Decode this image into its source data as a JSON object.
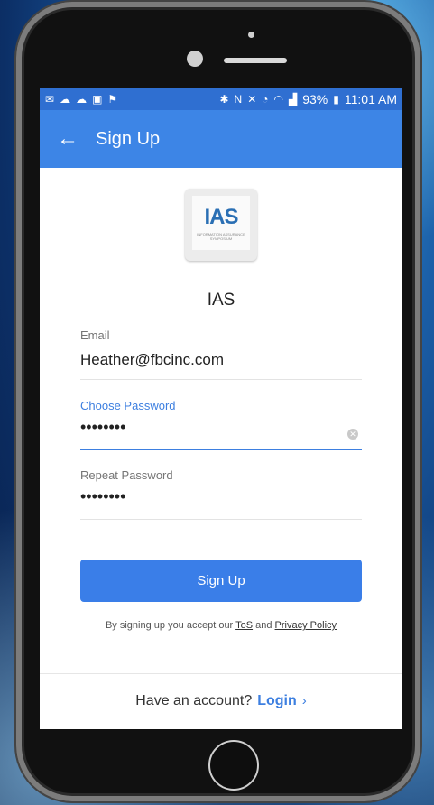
{
  "status_bar": {
    "battery": "93%",
    "time": "11:01 AM"
  },
  "app_bar": {
    "title": "Sign Up"
  },
  "org": {
    "logo_text": "IAS",
    "logo_subtitle": "INFORMATION ASSURANCE SYMPOSIUM",
    "name": "IAS"
  },
  "form": {
    "email_label": "Email",
    "email_value": "Heather@fbcinc.com",
    "choose_password_label": "Choose Password",
    "choose_password_value": "••••••••",
    "repeat_password_label": "Repeat Password",
    "repeat_password_value": "••••••••"
  },
  "actions": {
    "signup_label": "Sign Up",
    "terms_prefix": "By signing up you accept our",
    "tos_label": "ToS",
    "terms_and": "and",
    "privacy_label": "Privacy Policy",
    "have_account": "Have an account?",
    "login_label": "Login",
    "login_chevron": "›"
  },
  "colors": {
    "app_bar": "#3d85e6",
    "status_bar": "#2f6fd1",
    "accent": "#3d7fe0",
    "button": "#3a7ee8"
  }
}
